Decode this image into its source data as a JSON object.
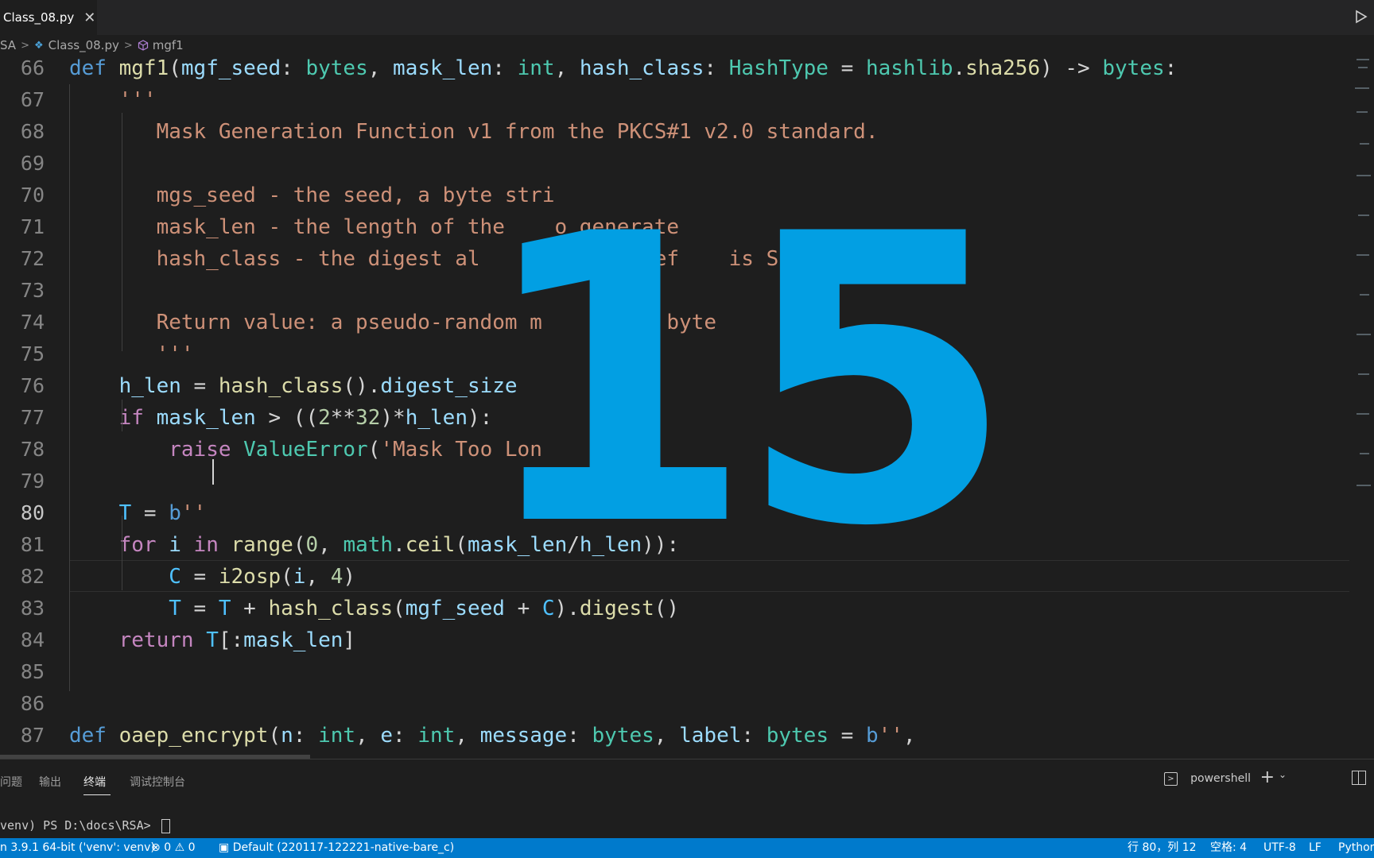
{
  "tab": {
    "label": "Class_08.py",
    "close": "✕"
  },
  "breadcrumb": {
    "folder": "SA",
    "file": "Class_08.py",
    "symbol": "mgf1"
  },
  "editor": {
    "current_line": 80,
    "lines": [
      {
        "n": "66"
      },
      {
        "n": "67"
      },
      {
        "n": "68"
      },
      {
        "n": "69"
      },
      {
        "n": "70"
      },
      {
        "n": "71"
      },
      {
        "n": "72"
      },
      {
        "n": "73"
      },
      {
        "n": "74"
      },
      {
        "n": "75"
      },
      {
        "n": "76"
      },
      {
        "n": "77"
      },
      {
        "n": "78"
      },
      {
        "n": "79"
      },
      {
        "n": "80"
      },
      {
        "n": "81"
      },
      {
        "n": "82"
      },
      {
        "n": "83"
      },
      {
        "n": "84"
      },
      {
        "n": "85"
      },
      {
        "n": "86"
      },
      {
        "n": "87"
      }
    ],
    "code": {
      "l66": [
        [
          "k",
          "def "
        ],
        [
          "f",
          "mgf1"
        ],
        [
          "o",
          "("
        ],
        [
          "p",
          "mgf_seed"
        ],
        [
          "o",
          ": "
        ],
        [
          "t",
          "bytes"
        ],
        [
          "o",
          ", "
        ],
        [
          "p",
          "mask_len"
        ],
        [
          "o",
          ": "
        ],
        [
          "t",
          "int"
        ],
        [
          "o",
          ", "
        ],
        [
          "p",
          "hash_class"
        ],
        [
          "o",
          ": "
        ],
        [
          "t",
          "HashType"
        ],
        [
          "o",
          " = "
        ],
        [
          "t",
          "hashlib"
        ],
        [
          "o",
          "."
        ],
        [
          "f",
          "sha256"
        ],
        [
          "o",
          ") -> "
        ],
        [
          "t",
          "bytes"
        ],
        [
          "o",
          ":"
        ]
      ],
      "l67": [
        [
          "s",
          "    '''"
        ]
      ],
      "l68": [
        [
          "s",
          "       Mask Generation Function v1 from the PKCS#1 v2.0 standard."
        ]
      ],
      "l69": [
        [
          "s",
          ""
        ]
      ],
      "l70": [
        [
          "s",
          "       mgs_seed - the seed, a byte stri"
        ]
      ],
      "l71": [
        [
          "s",
          "       mask_len - the length of the    o generate"
        ]
      ],
      "l72": [
        [
          "s",
          "       hash_class - the digest al      o use, def    is SHA1"
        ]
      ],
      "l73": [
        [
          "s",
          ""
        ]
      ],
      "l74": [
        [
          "s",
          "       Return value: a pseudo-random m     as a byte"
        ]
      ],
      "l75": [
        [
          "s",
          "       '''"
        ]
      ],
      "l76": [
        [
          "o",
          "    "
        ],
        [
          "p",
          "h_len"
        ],
        [
          "o",
          " = "
        ],
        [
          "f",
          "hash_class"
        ],
        [
          "o",
          "()."
        ],
        [
          "p",
          "digest_size"
        ]
      ],
      "l77": [
        [
          "o",
          "    "
        ],
        [
          "c",
          "if "
        ],
        [
          "p",
          "mask_len"
        ],
        [
          "o",
          " > (("
        ],
        [
          "n",
          "2"
        ],
        [
          "o",
          "**"
        ],
        [
          "n",
          "32"
        ],
        [
          "o",
          ")*"
        ],
        [
          "p",
          "h_len"
        ],
        [
          "o",
          "):"
        ]
      ],
      "l78": [
        [
          "o",
          "        "
        ],
        [
          "c",
          "raise "
        ],
        [
          "t",
          "ValueError"
        ],
        [
          "o",
          "("
        ],
        [
          "s",
          "'Mask Too Lon"
        ]
      ],
      "l79": [
        [
          "o",
          ""
        ]
      ],
      "l80": [
        [
          "o",
          "    "
        ],
        [
          "v",
          "T"
        ],
        [
          "o",
          " = "
        ],
        [
          "k",
          "b"
        ],
        [
          "s",
          "''"
        ]
      ],
      "l81": [
        [
          "o",
          "    "
        ],
        [
          "c",
          "for "
        ],
        [
          "p",
          "i"
        ],
        [
          "c",
          " in "
        ],
        [
          "f",
          "range"
        ],
        [
          "o",
          "("
        ],
        [
          "n",
          "0"
        ],
        [
          "o",
          ", "
        ],
        [
          "t",
          "math"
        ],
        [
          "o",
          "."
        ],
        [
          "f",
          "ceil"
        ],
        [
          "o",
          "("
        ],
        [
          "p",
          "mask_len"
        ],
        [
          "o",
          "/"
        ],
        [
          "p",
          "h_len"
        ],
        [
          "o",
          ")):"
        ]
      ],
      "l82": [
        [
          "o",
          "        "
        ],
        [
          "v",
          "C"
        ],
        [
          "o",
          " = "
        ],
        [
          "f",
          "i2osp"
        ],
        [
          "o",
          "("
        ],
        [
          "p",
          "i"
        ],
        [
          "o",
          ", "
        ],
        [
          "n",
          "4"
        ],
        [
          "o",
          ")"
        ]
      ],
      "l83": [
        [
          "o",
          "        "
        ],
        [
          "v",
          "T"
        ],
        [
          "o",
          " = "
        ],
        [
          "v",
          "T"
        ],
        [
          "o",
          " + "
        ],
        [
          "f",
          "hash_class"
        ],
        [
          "o",
          "("
        ],
        [
          "p",
          "mgf_seed"
        ],
        [
          "o",
          " + "
        ],
        [
          "v",
          "C"
        ],
        [
          "o",
          ")."
        ],
        [
          "f",
          "digest"
        ],
        [
          "o",
          "()"
        ]
      ],
      "l84": [
        [
          "o",
          "    "
        ],
        [
          "c",
          "return "
        ],
        [
          "v",
          "T"
        ],
        [
          "o",
          "[:"
        ],
        [
          "p",
          "mask_len"
        ],
        [
          "o",
          "]"
        ]
      ],
      "l85": [
        [
          "o",
          ""
        ]
      ],
      "l86": [
        [
          "o",
          ""
        ]
      ],
      "l87": [
        [
          "k",
          "def "
        ],
        [
          "f",
          "oaep_encrypt"
        ],
        [
          "o",
          "("
        ],
        [
          "p",
          "n"
        ],
        [
          "o",
          ": "
        ],
        [
          "t",
          "int"
        ],
        [
          "o",
          ", "
        ],
        [
          "p",
          "e"
        ],
        [
          "o",
          ": "
        ],
        [
          "t",
          "int"
        ],
        [
          "o",
          ", "
        ],
        [
          "p",
          "message"
        ],
        [
          "o",
          ": "
        ],
        [
          "t",
          "bytes"
        ],
        [
          "o",
          ", "
        ],
        [
          "p",
          "label"
        ],
        [
          "o",
          ": "
        ],
        [
          "t",
          "bytes"
        ],
        [
          "o",
          " = "
        ],
        [
          "k",
          "b"
        ],
        [
          "s",
          "''"
        ],
        [
          "o",
          ","
        ]
      ]
    }
  },
  "overlay": {
    "number": "15",
    "color": "#029fe3"
  },
  "panel": {
    "tabs": [
      "问题",
      "输出",
      "终端",
      "调试控制台"
    ],
    "active_tab": "终端",
    "shell": "powershell",
    "add": "+",
    "terminal_prompt": "venv) PS D:\\docs\\RSA> "
  },
  "statusbar": {
    "interpreter": "n 3.9.1 64-bit ('venv': venv)",
    "errors": "0",
    "warnings": "0",
    "config": "Default (220117-122221-native-bare_c)",
    "position": "行 80，列 12",
    "spaces": "空格: 4",
    "encoding": "UTF-8",
    "eol": "LF",
    "language": "Python",
    "color": "#007acc"
  }
}
